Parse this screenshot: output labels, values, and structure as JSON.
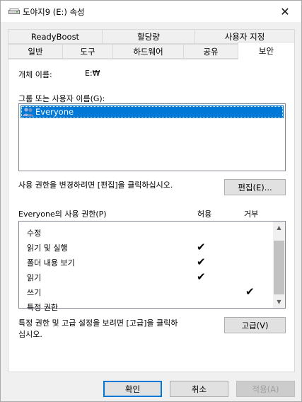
{
  "titlebar": {
    "title": "도야지9 (E:) 속성",
    "icon": "drive-icon",
    "close": "✕"
  },
  "tabs_row1": [
    "ReadyBoost",
    "할당량",
    "사용자 지정"
  ],
  "tabs_row2": [
    "일반",
    "도구",
    "하드웨어",
    "공유",
    "보안"
  ],
  "active_tab": "보안",
  "object": {
    "label": "개체 이름:",
    "value": "E:₩"
  },
  "group_list": {
    "label": "그룹 또는 사용자 이름(G):",
    "items": [
      {
        "name": "Everyone",
        "icon": "users-icon",
        "selected": true
      }
    ]
  },
  "edit": {
    "text": "사용 권한을 변경하려면 [편집]을 클릭하십시오.",
    "button": "편집(E)..."
  },
  "permissions": {
    "label": "Everyone의 사용 권한(P)",
    "allow_header": "허용",
    "deny_header": "거부",
    "rows": [
      {
        "name": "수정",
        "allow": false,
        "deny": false
      },
      {
        "name": "읽기 및 실행",
        "allow": true,
        "deny": false
      },
      {
        "name": "폴더 내용 보기",
        "allow": true,
        "deny": false
      },
      {
        "name": "읽기",
        "allow": true,
        "deny": false
      },
      {
        "name": "쓰기",
        "allow": false,
        "deny": true
      },
      {
        "name": "특정 권한",
        "allow": false,
        "deny": false
      }
    ],
    "check_glyph": "✔"
  },
  "advanced": {
    "text_line1": "특정 권한 및 고급 설정을 보려면 [고급]을 클릭하",
    "text_line2": "십시오.",
    "button": "고급(V)"
  },
  "footer": {
    "ok": "확인",
    "cancel": "취소",
    "apply": "적용(A)"
  }
}
